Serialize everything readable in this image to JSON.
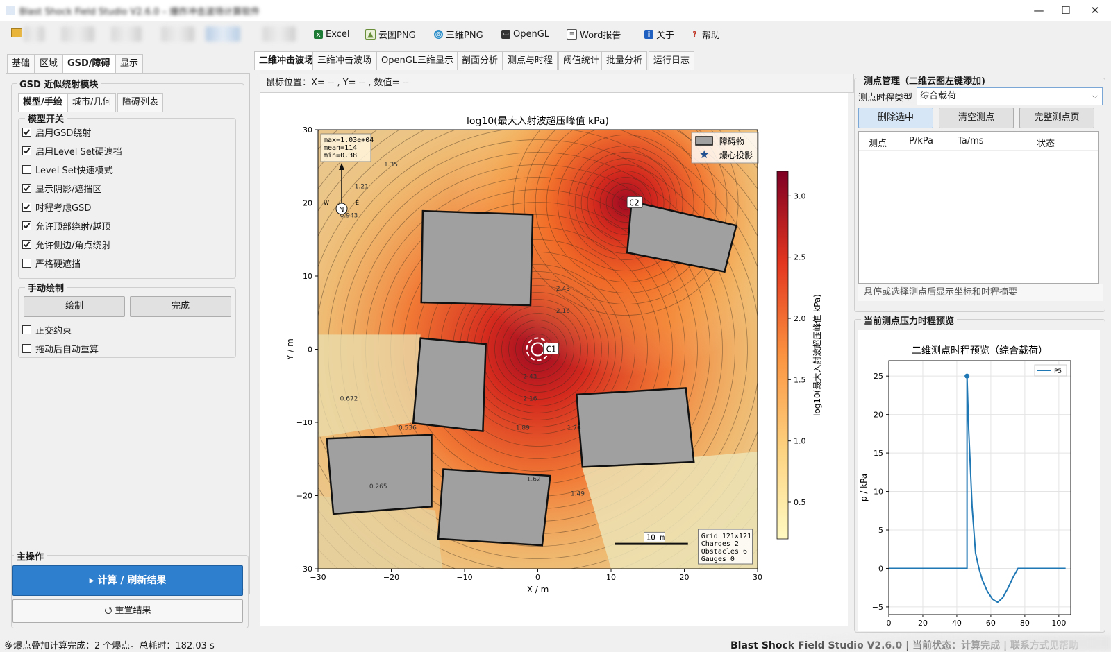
{
  "window": {
    "title": "Blast Shock Field Studio V2.6.0 – 爆炸冲击波场计算软件",
    "min_glyph": "—",
    "max_glyph": "☐",
    "close_glyph": "✕"
  },
  "toolbar": {
    "items": [
      {
        "label": "Excel",
        "icon": "excel-icon",
        "color": "#1e7b35"
      },
      {
        "label": "云图PNG",
        "icon": "image-icon",
        "color": "#6a8f3a"
      },
      {
        "label": "三维PNG",
        "icon": "globe-icon",
        "color": "#2f8fc9"
      },
      {
        "label": "OpenGL",
        "icon": "monitor-icon",
        "color": "#333333"
      },
      {
        "label": "Word报告",
        "icon": "document-icon",
        "color": "#555555"
      },
      {
        "label": "关于",
        "icon": "info-icon",
        "color": "#1f5fbf"
      },
      {
        "label": "帮助",
        "icon": "help-icon",
        "color": "#c0392b"
      }
    ]
  },
  "left": {
    "tabs": [
      "基础",
      "区域",
      "GSD/障碍",
      "显示"
    ],
    "active_tab": 2,
    "module_title": "GSD 近似绕射模块",
    "sub_tabs": [
      "模型/手绘",
      "城市/几何",
      "障碍列表"
    ],
    "switch_title": "模型开关",
    "switches": [
      {
        "label": "启用GSD绕射",
        "checked": true
      },
      {
        "label": "启用Level Set硬遮挡",
        "checked": true
      },
      {
        "label": "Level Set快速模式",
        "checked": false
      },
      {
        "label": "显示阴影/遮挡区",
        "checked": true
      },
      {
        "label": "时程考虑GSD",
        "checked": true
      },
      {
        "label": "允许顶部绕射/越顶",
        "checked": true
      },
      {
        "label": "允许侧边/角点绕射",
        "checked": true
      },
      {
        "label": "严格硬遮挡",
        "checked": false
      }
    ],
    "manual_title": "手动绘制",
    "draw_button": "绘制",
    "done_button": "完成",
    "manual_checks": [
      {
        "label": "正交约束",
        "checked": false
      },
      {
        "label": "拖动后自动重算",
        "checked": false
      }
    ],
    "main_ops_title": "主操作",
    "compute_button": "▸ 计算 / 刷新结果",
    "reset_button": "⭯ 重置结果"
  },
  "center": {
    "tabs": [
      "二维冲击波场",
      "三维冲击波场",
      "OpenGL三维显示",
      "剖面分析",
      "测点与时程",
      "阈值统计",
      "批量分析",
      "运行日志"
    ],
    "active_tab": 0,
    "mouse_readout": "鼠标位置：X= -- , Y= -- , 数值= --"
  },
  "chart_data": [
    {
      "type": "heatmap",
      "title": "log10(最大入射波超压峰值 kPa)",
      "xlabel": "X / m",
      "ylabel": "Y / m",
      "xlim": [
        -30,
        30
      ],
      "ylim": [
        -30,
        30
      ],
      "xticks": [
        -30,
        -20,
        -10,
        0,
        10,
        20,
        30
      ],
      "yticks": [
        -30,
        -20,
        -10,
        0,
        10,
        20,
        30
      ],
      "colorbar": {
        "label": "log10(最大入射波超压峰值 kPa)",
        "range": [
          0.2,
          3.2
        ],
        "ticks": [
          0.5,
          1.0,
          1.5,
          2.0,
          2.5,
          3.0
        ]
      },
      "charges": [
        {
          "name": "C1",
          "x": 0,
          "y": 0
        },
        {
          "name": "C2",
          "x": 12,
          "y": 20
        }
      ],
      "obstacles": [
        [
          [
            -15.7,
            18.9
          ],
          [
            -0.7,
            18.4
          ],
          [
            -1,
            6
          ],
          [
            -15.9,
            6.4
          ]
        ],
        [
          [
            12.8,
            20.2
          ],
          [
            27.1,
            16.9
          ],
          [
            25.5,
            10.6
          ],
          [
            12.2,
            13.2
          ]
        ],
        [
          [
            -16,
            1.5
          ],
          [
            -7.1,
            0.7
          ],
          [
            -7.5,
            -11.2
          ],
          [
            -17,
            -10.1
          ]
        ],
        [
          [
            5.3,
            -6.2
          ],
          [
            20.2,
            -5.3
          ],
          [
            21.3,
            -15.4
          ],
          [
            6.1,
            -16.1
          ]
        ],
        [
          [
            -28.8,
            -12.2
          ],
          [
            -14.5,
            -11.7
          ],
          [
            -14.5,
            -21.5
          ],
          [
            -27.9,
            -22.5
          ]
        ],
        [
          [
            -12.9,
            -16.4
          ],
          [
            1.7,
            -17.3
          ],
          [
            0.6,
            -26.8
          ],
          [
            -13.6,
            -25.9
          ]
        ]
      ],
      "legend": {
        "position": "top-right",
        "entries": [
          "障碍物",
          "爆心投影"
        ]
      },
      "stats_box": [
        "max=1.03e+04",
        "mean=114",
        "min=0.38"
      ],
      "info_box": [
        "Grid 121×121",
        "Charges 2",
        "Obstacles 6",
        "Gauges 0"
      ],
      "compass": {
        "north": "N",
        "west": "W",
        "east": "E"
      },
      "scale_bar": "10 m",
      "contour_labels": [
        "2.43",
        "2.16",
        "1.89",
        "1.62",
        "1.35",
        "1.21",
        "1.76",
        "1.49",
        "0.943",
        "0.672",
        "0.536",
        "0.265",
        "2.16",
        "2.43"
      ]
    },
    {
      "type": "line",
      "title": "二维测点时程预览（综合载荷）",
      "xlabel": "",
      "ylabel": "p / kPa",
      "xlim": [
        0,
        107
      ],
      "ylim": [
        -6,
        27
      ],
      "xticks": [
        0,
        20,
        40,
        60,
        80,
        100
      ],
      "yticks": [
        -5,
        0,
        5,
        10,
        15,
        20,
        25
      ],
      "series": [
        {
          "name": "P5",
          "color": "#1f77b4",
          "x": [
            0,
            46,
            46,
            47,
            49,
            51,
            53,
            55,
            58,
            61,
            64,
            67,
            70,
            73,
            76,
            80,
            90,
            104
          ],
          "y": [
            0,
            0,
            25,
            18,
            8,
            2,
            0,
            -1.5,
            -3,
            -4,
            -4.4,
            -3.8,
            -2.6,
            -1.2,
            0,
            0,
            0,
            0
          ]
        }
      ],
      "peak_marker": {
        "x": 46,
        "y": 25
      }
    }
  ],
  "right": {
    "gauge_title": "测点管理（二维云图左键添加)",
    "type_label": "测点时程类型",
    "type_value": "综合载荷",
    "delete_button": "删除选中",
    "clear_button": "清空测点",
    "full_button": "完整测点页",
    "table_headers": [
      "测点",
      "P/kPa",
      "Ta/ms",
      "状态"
    ],
    "hint": "悬停或选择测点后显示坐标和时程摘要",
    "preview_title": "当前测点压力时程预览"
  },
  "statusbar": {
    "message": "多爆点叠加计算完成：2 个爆点。总耗时：182.03 s",
    "right_text": "Blast Shock Field Studio V2.6.0 | 当前状态：计算完成 | 联系方式见帮助"
  }
}
